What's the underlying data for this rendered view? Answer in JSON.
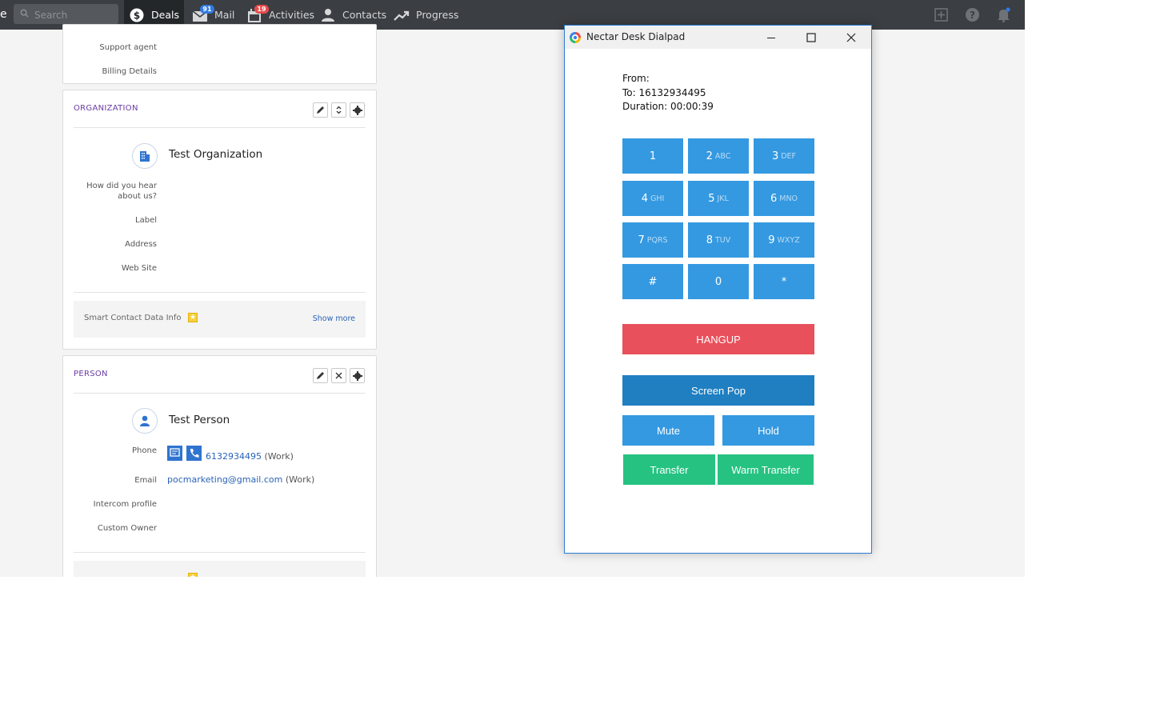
{
  "nav": {
    "search_placeholder": "Search",
    "items": [
      {
        "label": "Deals",
        "icon": "dollar-icon"
      },
      {
        "label": "Mail",
        "icon": "mail-icon",
        "badge": "91"
      },
      {
        "label": "Activities",
        "icon": "calendar-icon",
        "badge": "19"
      },
      {
        "label": "Contacts",
        "icon": "person-icon"
      },
      {
        "label": "Progress",
        "icon": "trend-icon"
      }
    ],
    "right_icons": [
      "add-icon",
      "help-icon",
      "bell-icon"
    ]
  },
  "top_panel": {
    "fields": [
      "Support agent",
      "Billing Details"
    ]
  },
  "organization": {
    "section_title": "ORGANIZATION",
    "name": "Test Organization",
    "fields": [
      "How did you hear about us?",
      "Label",
      "Address",
      "Web Site"
    ],
    "field_how_line1": "How did you hear",
    "field_how_line2": "about us?",
    "smart_text": "Smart Contact Data Info",
    "show_more": "Show more"
  },
  "person": {
    "section_title": "PERSON",
    "name": "Test Person",
    "phone_label": "Phone",
    "phone_value": "6132934495",
    "phone_type": "(Work)",
    "email_label": "Email",
    "email_value": "pocmarketing@gmail.com",
    "email_type": "(Work)",
    "intercom_label": "Intercom profile",
    "owner_label": "Custom Owner"
  },
  "dialpad": {
    "title": "Nectar Desk Dialpad",
    "from": "From:",
    "to": "To: 16132934495",
    "duration": "Duration: 00:00:39",
    "keys": [
      {
        "num": "1",
        "sub": ""
      },
      {
        "num": "2",
        "sub": "ABC"
      },
      {
        "num": "3",
        "sub": "DEF"
      },
      {
        "num": "4",
        "sub": "GHI"
      },
      {
        "num": "5",
        "sub": "JKL"
      },
      {
        "num": "6",
        "sub": "MNO"
      },
      {
        "num": "7",
        "sub": "PQRS"
      },
      {
        "num": "8",
        "sub": "TUV"
      },
      {
        "num": "9",
        "sub": "WXYZ"
      },
      {
        "num": "#",
        "sub": ""
      },
      {
        "num": "0",
        "sub": ""
      },
      {
        "num": "*",
        "sub": ""
      }
    ],
    "hangup": "HANGUP",
    "screen_pop": "Screen Pop",
    "mute": "Mute",
    "hold": "Hold",
    "transfer": "Transfer",
    "warm_transfer": "Warm Transfer",
    "colors": {
      "key": "#3499e1",
      "hangup": "#e8505b",
      "screen_pop": "#1f7fc1",
      "transfer": "#26c281"
    }
  }
}
